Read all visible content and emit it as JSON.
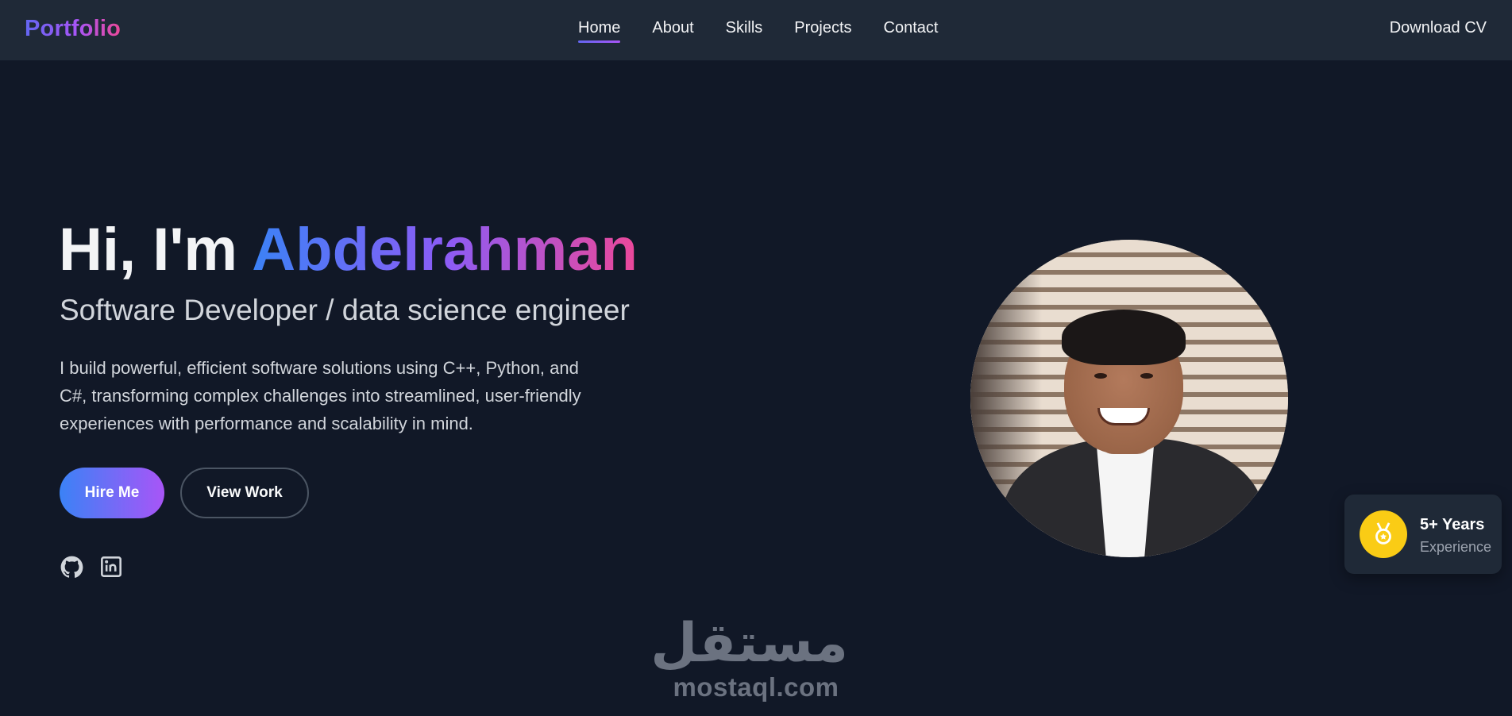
{
  "navbar": {
    "logo": "Portfolio",
    "links": [
      {
        "label": "Home",
        "active": true
      },
      {
        "label": "About",
        "active": false
      },
      {
        "label": "Skills",
        "active": false
      },
      {
        "label": "Projects",
        "active": false
      },
      {
        "label": "Contact",
        "active": false
      }
    ],
    "download_cv": "Download CV"
  },
  "hero": {
    "greeting": "Hi, I'm",
    "name": "Abdelrahman",
    "subtitle": "Software Developer / data science engineer",
    "description": "I build powerful, efficient software solutions using C++, Python, and C#, transforming complex challenges into streamlined, user-friendly experiences with performance and scalability in mind.",
    "buttons": {
      "hire": "Hire Me",
      "view_work": "View Work"
    },
    "social": [
      "github-icon",
      "linkedin-icon"
    ]
  },
  "experience": {
    "years": "5+ Years",
    "label": "Experience",
    "icon": "medal-icon"
  },
  "watermark": {
    "arabic": "مستقل",
    "latin": "mostaql.com"
  },
  "colors": {
    "background": "#111827",
    "navbar": "#1f2937",
    "gradient_start": "#3b82f6",
    "gradient_mid": "#8b5cf6",
    "gradient_end": "#ec4899",
    "medal": "#facc15"
  }
}
